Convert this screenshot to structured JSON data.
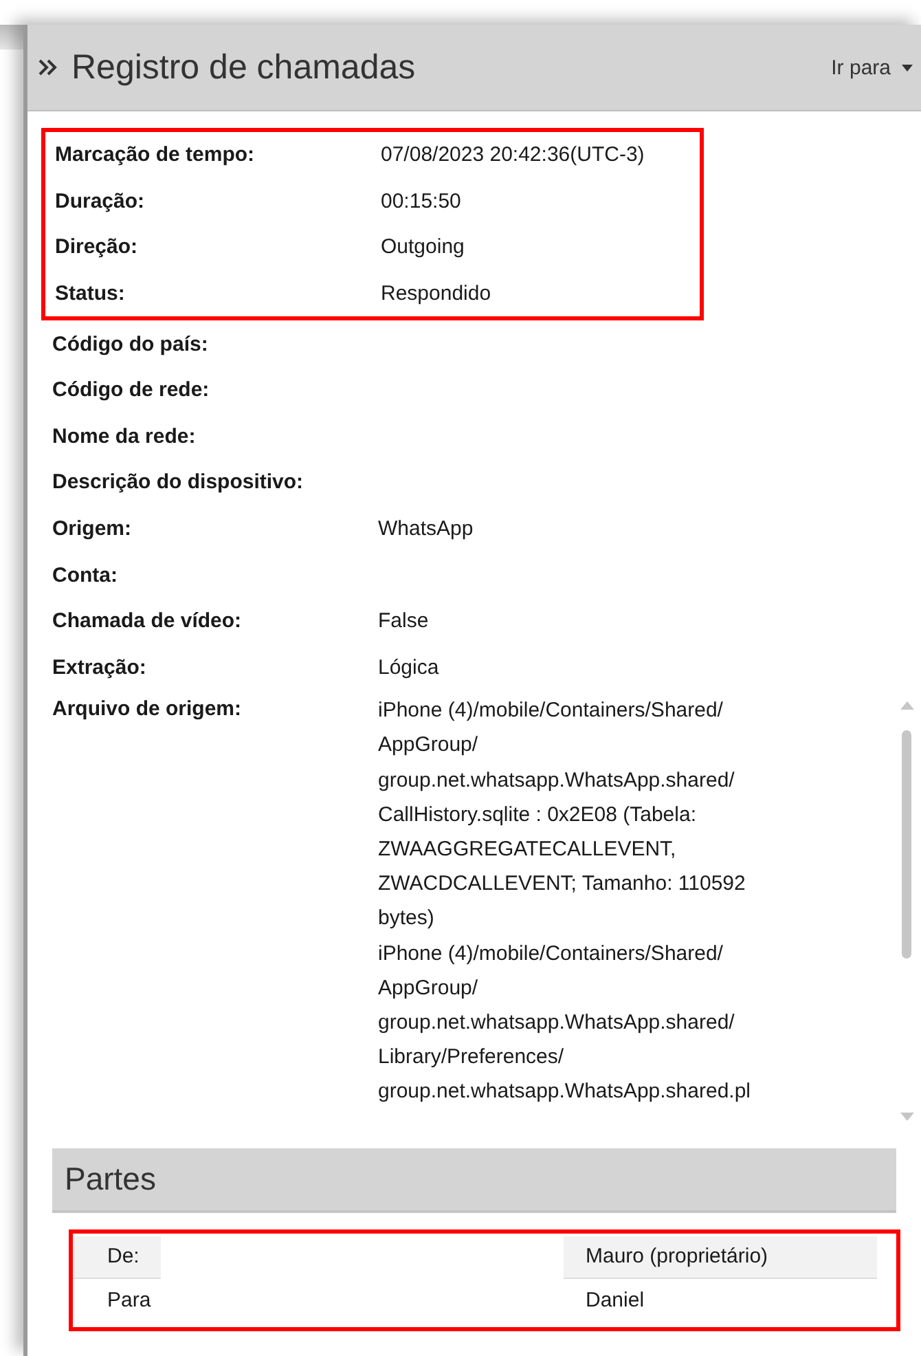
{
  "header": {
    "title": "Registro de chamadas",
    "goto": "Ir para"
  },
  "fields": [
    {
      "label": "Marcação de tempo:",
      "value": "07/08/2023 20:42:36(UTC-3)",
      "highlighted": true
    },
    {
      "label": "Duração:",
      "value": "00:15:50",
      "highlighted": true
    },
    {
      "label": "Direção:",
      "value": "Outgoing",
      "highlighted": true
    },
    {
      "label": "Status:",
      "value": "Respondido",
      "highlighted": true
    },
    {
      "label": "Código do país:",
      "highlighted": false
    },
    {
      "label": "Código de rede:",
      "highlighted": false
    },
    {
      "label": "Nome da rede:",
      "highlighted": false
    },
    {
      "label": "Descrição do dispositivo:",
      "highlighted": false
    },
    {
      "label": "Origem:",
      "value": "WhatsApp",
      "highlighted": false
    },
    {
      "label": "Conta:",
      "highlighted": false
    },
    {
      "label": "Chamada de vídeo:",
      "value": "False",
      "highlighted": false
    },
    {
      "label": "Extração:",
      "value": "Lógica",
      "highlighted": false
    }
  ],
  "source": {
    "label": "Arquivo de origem:",
    "entries": [
      {
        "lines": [
          "iPhone (4)/mobile/Containers/Shared/",
          "AppGroup/",
          "group.net.whatsapp.WhatsApp.shared/",
          "CallHistory.sqlite : 0x2E08 (Tabela:",
          "ZWAAGGREGATECALLEVENT,",
          "ZWACDCALLEVENT; Tamanho: 110592",
          "bytes)"
        ]
      },
      {
        "lines": [
          "iPhone (4)/mobile/Containers/Shared/",
          "AppGroup/",
          "group.net.whatsapp.WhatsApp.shared/",
          "Library/Preferences/",
          "group.net.whatsapp.WhatsApp.shared.pl"
        ]
      }
    ]
  },
  "parties": {
    "title": "Partes",
    "highlighted": true,
    "rows": [
      {
        "label": "De:",
        "value": "Mauro (proprietário)"
      },
      {
        "label": "Para",
        "value": "Daniel"
      }
    ]
  }
}
